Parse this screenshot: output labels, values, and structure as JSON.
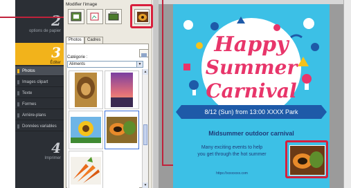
{
  "wizard": {
    "step2": {
      "number": "2",
      "label": "options de papier"
    },
    "step3": {
      "number": "3",
      "label": "Éditer"
    },
    "step4": {
      "number": "4",
      "label": "Imprimer"
    },
    "subitems": [
      "Photos",
      "Images clipart",
      "Texte",
      "Formes",
      "Arrière-plans",
      "Données variables"
    ]
  },
  "panel": {
    "title": "Modifier l'image",
    "tabs": [
      "Photos",
      "Cadres"
    ],
    "category_label": "Catégorie :",
    "category_value": "Aliments",
    "thumbnails": [
      "lion",
      "sunset",
      "sunflower",
      "papaya",
      "carrots"
    ]
  },
  "poster": {
    "headline_1": "Happy",
    "headline_2": "Summer",
    "headline_3": "Carnival",
    "date_line": "8/12 (Sun) from 13:00  XXXX Park",
    "subtitle": "Midsummer outdoor carnival",
    "body_1": "Many exciting events to help",
    "body_2": "you get through the hot summer",
    "url": "https://xxxxxxxx.com"
  },
  "colors": {
    "accent_highlight": "#d81f3c",
    "poster_bg": "#3cc0e6",
    "poster_headline": "#e8356a",
    "wizard_active": "#f2b31b"
  }
}
